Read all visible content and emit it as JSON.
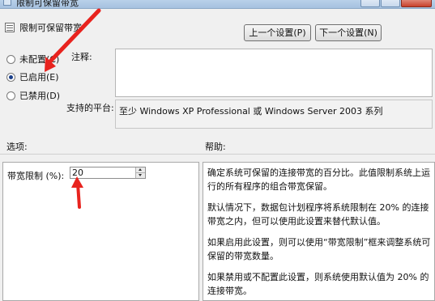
{
  "window": {
    "title": "限制可保留带宽"
  },
  "header": {
    "title": "限制可保留带宽"
  },
  "nav": {
    "prev_label": "上一个设置(P)",
    "next_label": "下一个设置(N)"
  },
  "state": {
    "options": [
      {
        "label": "未配置(C)",
        "checked": false
      },
      {
        "label": "已启用(E)",
        "checked": true
      },
      {
        "label": "已禁用(D)",
        "checked": false
      }
    ]
  },
  "comment": {
    "label": "注释:",
    "value": ""
  },
  "platform": {
    "label": "支持的平台:",
    "value": "至少 Windows XP Professional 或 Windows Server 2003 系列"
  },
  "options_section": {
    "label": "选项:",
    "bandwidth_label": "带宽限制 (%):",
    "bandwidth_value": "20"
  },
  "help_section": {
    "label": "帮助:",
    "paragraphs": [
      "确定系统可保留的连接带宽的百分比。此值限制系统上运行的所有程序的组合带宽保留。",
      "默认情况下，数据包计划程序将系统限制在 20% 的连接带宽之内，但可以使用此设置来替代默认值。",
      "如果启用此设置，则可以使用“带宽限制”框来调整系统可保留的带宽数量。",
      "如果禁用或不配置此设置，则系统使用默认值为 20% 的连接带宽。"
    ]
  },
  "annotations": {
    "arrow_color": "#e8231e"
  }
}
